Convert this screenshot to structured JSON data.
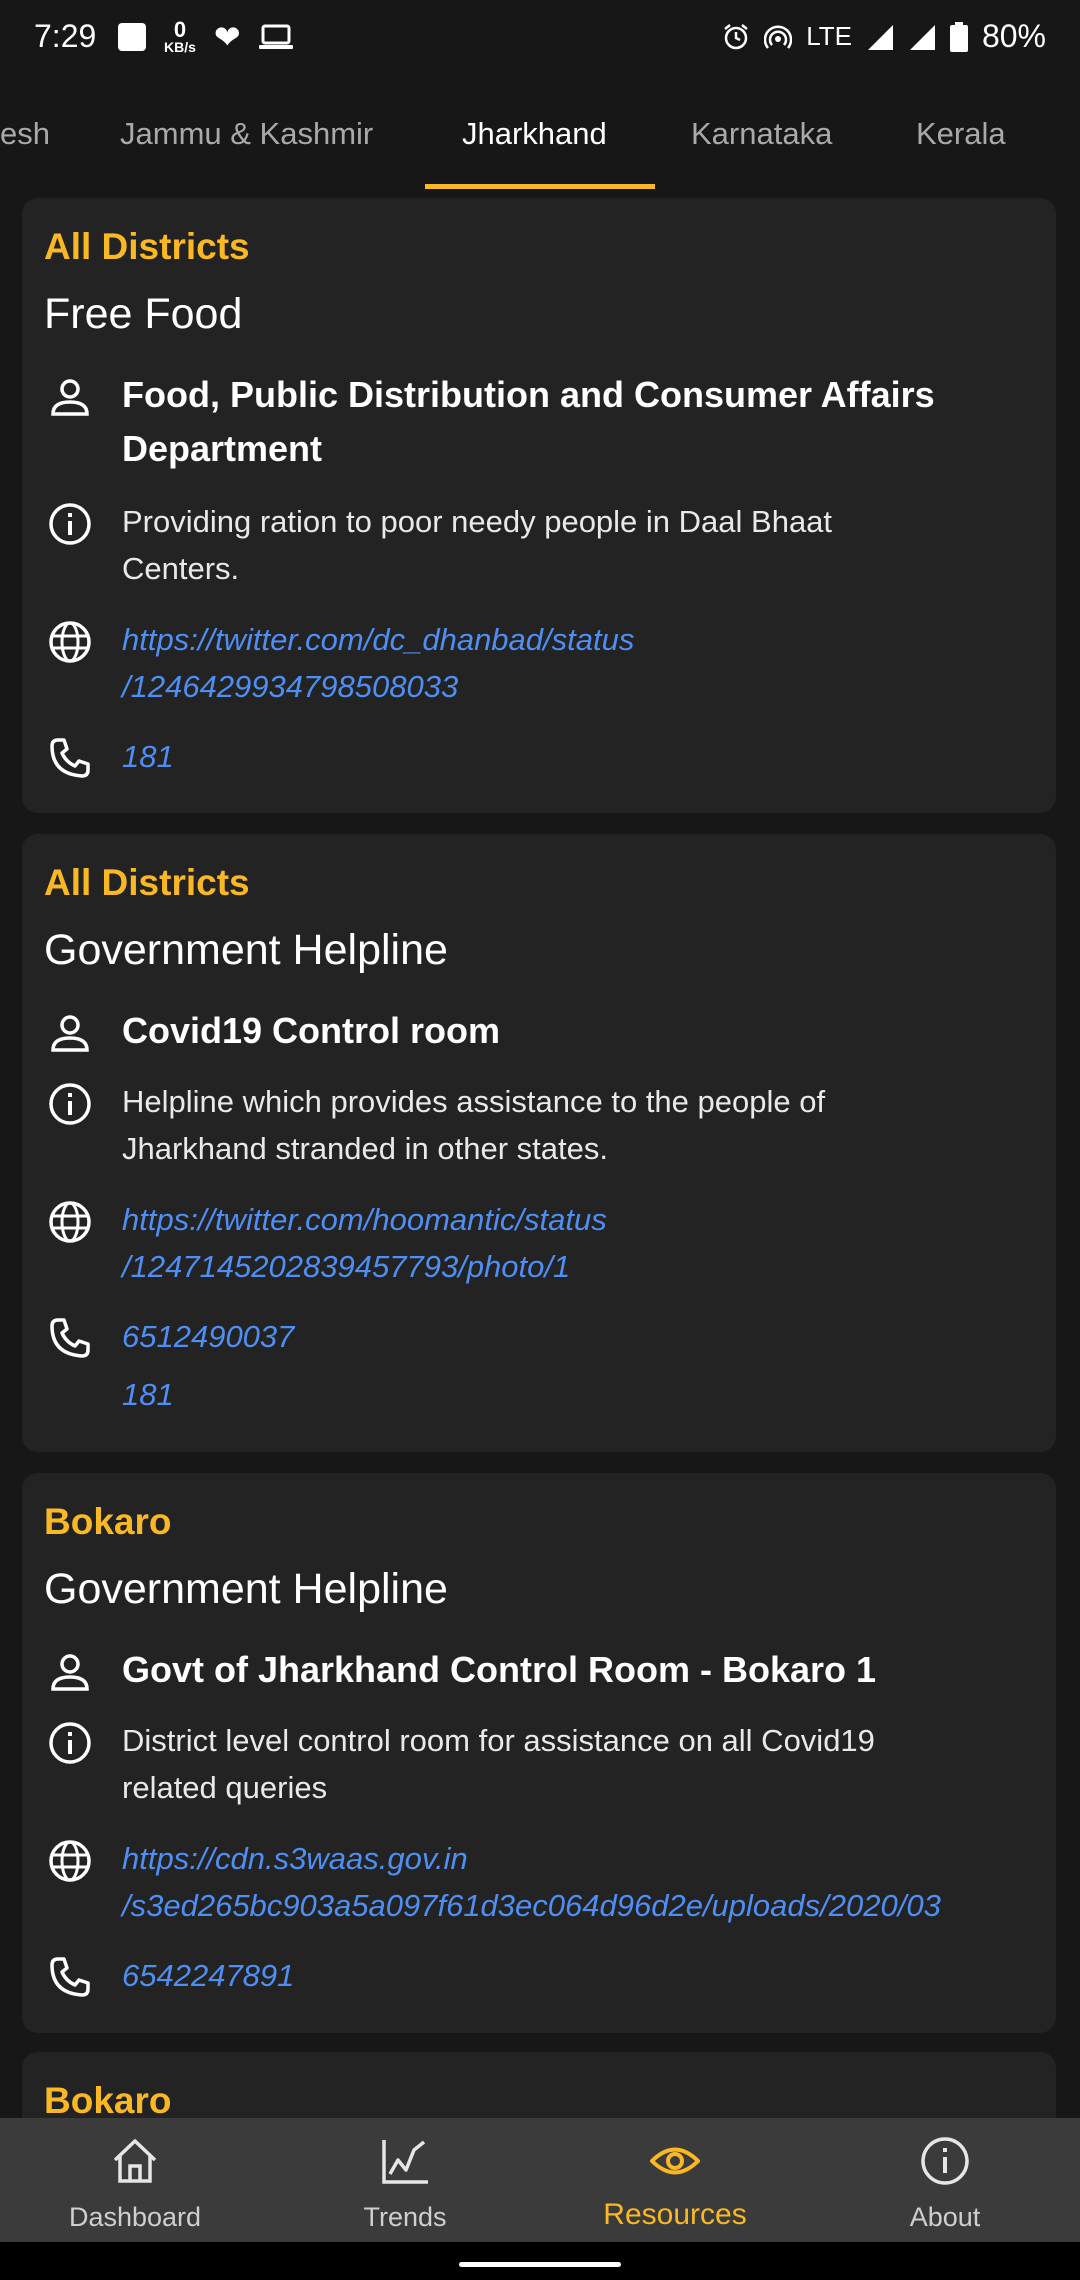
{
  "status_bar": {
    "time": "7:29",
    "net_speed_value": "0",
    "net_speed_unit": "KB/s",
    "network": "LTE",
    "battery": "80%"
  },
  "tabs": {
    "items": [
      "esh",
      "Jammu & Kashmir",
      "Jharkhand",
      "Karnataka",
      "Kerala"
    ],
    "active": "Jharkhand"
  },
  "cards": [
    {
      "district": "All Districts",
      "category": "Free Food",
      "org_line1": "Food, Public Distribution and Consumer Affairs",
      "org_line2": "Department",
      "desc_line1": "Providing ration to poor needy people in Daal Bhaat",
      "desc_line2": "Centers.",
      "link_line1": "https://twitter.com/dc_dhanbad/status",
      "link_line2": "/1246429934798508033",
      "phones": [
        "181"
      ]
    },
    {
      "district": "All Districts",
      "category": "Government Helpline",
      "org_line1": "Covid19 Control room",
      "desc_line1": "Helpline which provides assistance to the people of",
      "desc_line2": "Jharkhand stranded in other states.",
      "link_line1": "https://twitter.com/hoomantic/status",
      "link_line2": "/1247145202839457793/photo/1",
      "phones": [
        "6512490037",
        "181"
      ]
    },
    {
      "district": "Bokaro",
      "category": "Government Helpline",
      "org_line1": "Govt of Jharkhand Control Room - Bokaro 1",
      "desc_line1": "District level control room for assistance on all Covid19",
      "desc_line2": "related queries",
      "link_line1": "https://cdn.s3waas.gov.in",
      "link_line2": "/s3ed265bc903a5a097f61d3ec064d96d2e/uploads/2020/03",
      "phones": [
        "6542247891"
      ]
    },
    {
      "district": "Bokaro"
    }
  ],
  "bottom_nav": {
    "items": [
      "Dashboard",
      "Trends",
      "Resources",
      "About"
    ],
    "active": "Resources"
  },
  "colors": {
    "accent": "#f9b824",
    "link": "#4f8ef3",
    "card_bg": "#232323",
    "page_bg": "#171717",
    "nav_bg": "#3b3b3b"
  }
}
